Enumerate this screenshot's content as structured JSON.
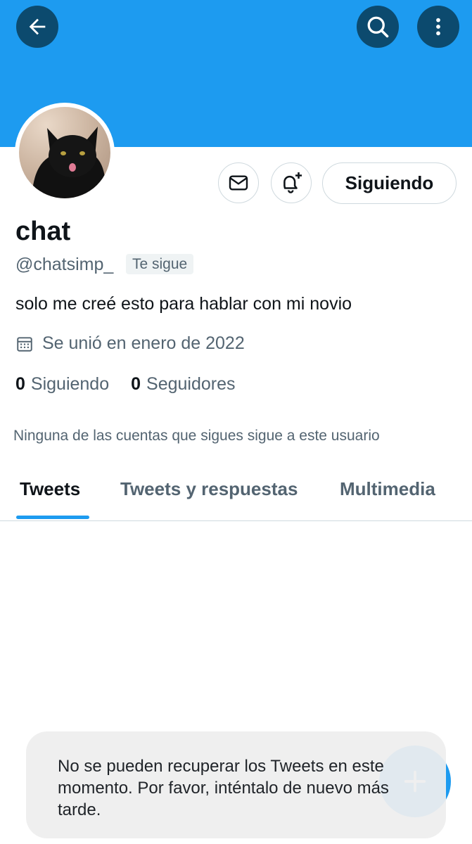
{
  "header": {
    "back_icon": "arrow-left-icon",
    "search_icon": "search-icon",
    "more_icon": "more-vertical-icon",
    "banner_color": "#1d9bf0"
  },
  "profile": {
    "display_name": "chat",
    "handle": "@chatsimp_",
    "follows_you_badge": "Te sigue",
    "bio": "solo me creé esto para hablar con mi novio",
    "joined": "Se unió en enero de 2022",
    "following_count": "0",
    "following_label": "Siguiendo",
    "followers_count": "0",
    "followers_label": "Seguidores",
    "mutuals_note": "Ninguna de las cuentas que sigues sigue a este usuario"
  },
  "actions": {
    "message_icon": "envelope-icon",
    "notify_icon": "bell-plus-icon",
    "follow_button_label": "Siguiendo"
  },
  "tabs": [
    {
      "label": "Tweets",
      "active": true
    },
    {
      "label": "Tweets y respuestas",
      "active": false
    },
    {
      "label": "Multimedia",
      "active": false
    }
  ],
  "toast": {
    "message": "No se pueden recuperar los Tweets en este momento. Por favor, inténtalo de nuevo más tarde."
  },
  "fab": {
    "icon": "plus-icon",
    "color": "#1d9bf0"
  }
}
